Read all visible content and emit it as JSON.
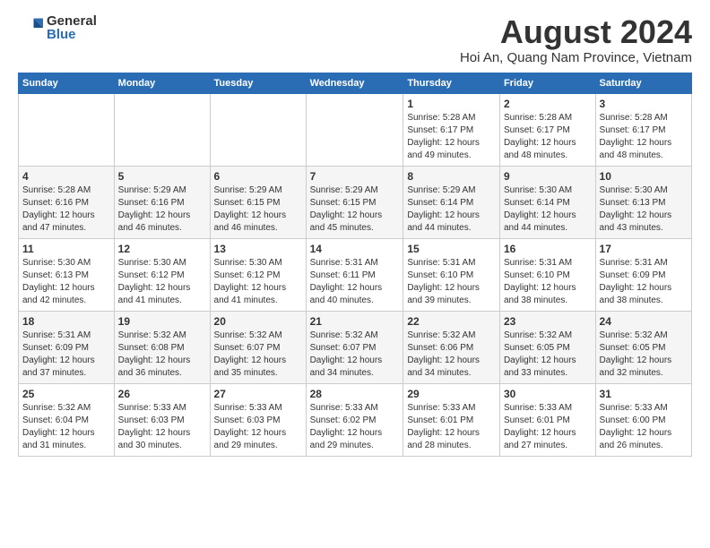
{
  "logo": {
    "general": "General",
    "blue": "Blue"
  },
  "title": {
    "month_year": "August 2024",
    "location": "Hoi An, Quang Nam Province, Vietnam"
  },
  "days_of_week": [
    "Sunday",
    "Monday",
    "Tuesday",
    "Wednesday",
    "Thursday",
    "Friday",
    "Saturday"
  ],
  "weeks": [
    [
      {
        "day": "",
        "info": ""
      },
      {
        "day": "",
        "info": ""
      },
      {
        "day": "",
        "info": ""
      },
      {
        "day": "",
        "info": ""
      },
      {
        "day": "1",
        "info": "Sunrise: 5:28 AM\nSunset: 6:17 PM\nDaylight: 12 hours\nand 49 minutes."
      },
      {
        "day": "2",
        "info": "Sunrise: 5:28 AM\nSunset: 6:17 PM\nDaylight: 12 hours\nand 48 minutes."
      },
      {
        "day": "3",
        "info": "Sunrise: 5:28 AM\nSunset: 6:17 PM\nDaylight: 12 hours\nand 48 minutes."
      }
    ],
    [
      {
        "day": "4",
        "info": "Sunrise: 5:28 AM\nSunset: 6:16 PM\nDaylight: 12 hours\nand 47 minutes."
      },
      {
        "day": "5",
        "info": "Sunrise: 5:29 AM\nSunset: 6:16 PM\nDaylight: 12 hours\nand 46 minutes."
      },
      {
        "day": "6",
        "info": "Sunrise: 5:29 AM\nSunset: 6:15 PM\nDaylight: 12 hours\nand 46 minutes."
      },
      {
        "day": "7",
        "info": "Sunrise: 5:29 AM\nSunset: 6:15 PM\nDaylight: 12 hours\nand 45 minutes."
      },
      {
        "day": "8",
        "info": "Sunrise: 5:29 AM\nSunset: 6:14 PM\nDaylight: 12 hours\nand 44 minutes."
      },
      {
        "day": "9",
        "info": "Sunrise: 5:30 AM\nSunset: 6:14 PM\nDaylight: 12 hours\nand 44 minutes."
      },
      {
        "day": "10",
        "info": "Sunrise: 5:30 AM\nSunset: 6:13 PM\nDaylight: 12 hours\nand 43 minutes."
      }
    ],
    [
      {
        "day": "11",
        "info": "Sunrise: 5:30 AM\nSunset: 6:13 PM\nDaylight: 12 hours\nand 42 minutes."
      },
      {
        "day": "12",
        "info": "Sunrise: 5:30 AM\nSunset: 6:12 PM\nDaylight: 12 hours\nand 41 minutes."
      },
      {
        "day": "13",
        "info": "Sunrise: 5:30 AM\nSunset: 6:12 PM\nDaylight: 12 hours\nand 41 minutes."
      },
      {
        "day": "14",
        "info": "Sunrise: 5:31 AM\nSunset: 6:11 PM\nDaylight: 12 hours\nand 40 minutes."
      },
      {
        "day": "15",
        "info": "Sunrise: 5:31 AM\nSunset: 6:10 PM\nDaylight: 12 hours\nand 39 minutes."
      },
      {
        "day": "16",
        "info": "Sunrise: 5:31 AM\nSunset: 6:10 PM\nDaylight: 12 hours\nand 38 minutes."
      },
      {
        "day": "17",
        "info": "Sunrise: 5:31 AM\nSunset: 6:09 PM\nDaylight: 12 hours\nand 38 minutes."
      }
    ],
    [
      {
        "day": "18",
        "info": "Sunrise: 5:31 AM\nSunset: 6:09 PM\nDaylight: 12 hours\nand 37 minutes."
      },
      {
        "day": "19",
        "info": "Sunrise: 5:32 AM\nSunset: 6:08 PM\nDaylight: 12 hours\nand 36 minutes."
      },
      {
        "day": "20",
        "info": "Sunrise: 5:32 AM\nSunset: 6:07 PM\nDaylight: 12 hours\nand 35 minutes."
      },
      {
        "day": "21",
        "info": "Sunrise: 5:32 AM\nSunset: 6:07 PM\nDaylight: 12 hours\nand 34 minutes."
      },
      {
        "day": "22",
        "info": "Sunrise: 5:32 AM\nSunset: 6:06 PM\nDaylight: 12 hours\nand 34 minutes."
      },
      {
        "day": "23",
        "info": "Sunrise: 5:32 AM\nSunset: 6:05 PM\nDaylight: 12 hours\nand 33 minutes."
      },
      {
        "day": "24",
        "info": "Sunrise: 5:32 AM\nSunset: 6:05 PM\nDaylight: 12 hours\nand 32 minutes."
      }
    ],
    [
      {
        "day": "25",
        "info": "Sunrise: 5:32 AM\nSunset: 6:04 PM\nDaylight: 12 hours\nand 31 minutes."
      },
      {
        "day": "26",
        "info": "Sunrise: 5:33 AM\nSunset: 6:03 PM\nDaylight: 12 hours\nand 30 minutes."
      },
      {
        "day": "27",
        "info": "Sunrise: 5:33 AM\nSunset: 6:03 PM\nDaylight: 12 hours\nand 29 minutes."
      },
      {
        "day": "28",
        "info": "Sunrise: 5:33 AM\nSunset: 6:02 PM\nDaylight: 12 hours\nand 29 minutes."
      },
      {
        "day": "29",
        "info": "Sunrise: 5:33 AM\nSunset: 6:01 PM\nDaylight: 12 hours\nand 28 minutes."
      },
      {
        "day": "30",
        "info": "Sunrise: 5:33 AM\nSunset: 6:01 PM\nDaylight: 12 hours\nand 27 minutes."
      },
      {
        "day": "31",
        "info": "Sunrise: 5:33 AM\nSunset: 6:00 PM\nDaylight: 12 hours\nand 26 minutes."
      }
    ]
  ]
}
